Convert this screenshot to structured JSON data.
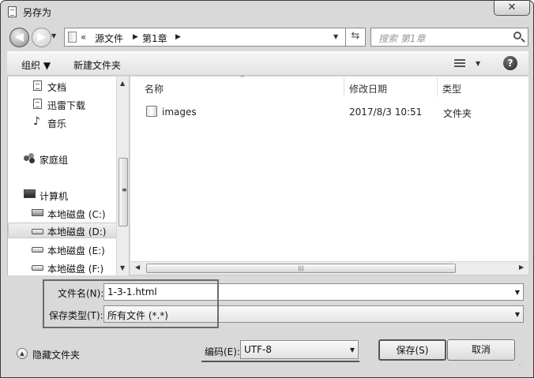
{
  "window": {
    "title": "另存为",
    "close_glyph": "✕"
  },
  "nav": {
    "back_glyph": "◀",
    "forward_glyph": "▶",
    "history_glyph": "▼",
    "address": {
      "overflow": "«",
      "crumbs": [
        "源文件",
        "第1章"
      ],
      "separator": "▶",
      "dropdown_glyph": "▼"
    },
    "refresh_glyph": "⇆",
    "search": {
      "placeholder": "搜索 第1章"
    }
  },
  "toolbar": {
    "organize": "组织 ▼",
    "new_folder": "新建文件夹",
    "view_drop": "▼",
    "help": "?"
  },
  "sidebar": {
    "items": [
      {
        "label": "文档",
        "icon": "document-icon"
      },
      {
        "label": "迅雷下载",
        "icon": "document-icon"
      },
      {
        "label": "音乐",
        "icon": "music-icon"
      },
      {
        "label": "家庭组",
        "icon": "homegroup-icon"
      },
      {
        "label": "计算机",
        "icon": "computer-icon"
      },
      {
        "label": "本地磁盘 (C:)",
        "icon": "system-drive-icon"
      },
      {
        "label": "本地磁盘 (D:)",
        "icon": "drive-icon",
        "selected": true
      },
      {
        "label": "本地磁盘 (E:)",
        "icon": "drive-icon"
      },
      {
        "label": "本地磁盘 (F:)",
        "icon": "drive-icon"
      }
    ],
    "scroll_up": "▲",
    "scroll_down": "▼",
    "grip": "≡"
  },
  "filelist": {
    "columns": [
      "名称",
      "修改日期",
      "类型"
    ],
    "sort_glyph": "^",
    "rows": [
      {
        "name": "images",
        "modified": "2017/8/3 10:51",
        "type": "文件夹"
      }
    ],
    "hscroll": {
      "left": "◀",
      "right": "▶",
      "grip": "|||"
    }
  },
  "form": {
    "filename": {
      "label": "文件名(N):",
      "value": "1-3-1.html"
    },
    "filetype": {
      "label": "保存类型(T):",
      "value": "所有文件  (*.*)"
    },
    "dropdown_glyph": "▼"
  },
  "footer": {
    "hide_folders": "隐藏文件夹",
    "hide_glyph": "▲",
    "encoding_label": "编码(E):",
    "encoding_value": "UTF-8",
    "save": "保存(S)",
    "cancel": "取消",
    "grip": "⋰"
  }
}
